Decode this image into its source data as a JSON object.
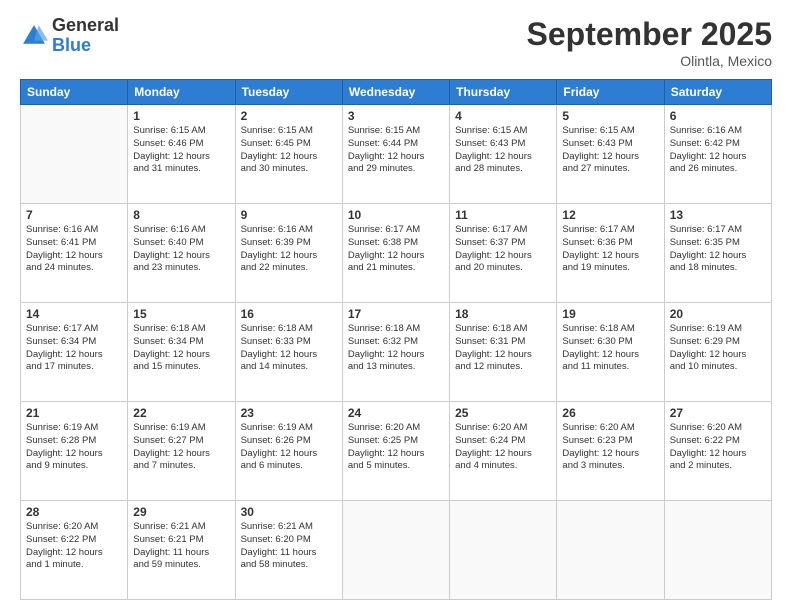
{
  "logo": {
    "general": "General",
    "blue": "Blue"
  },
  "header": {
    "month": "September 2025",
    "location": "Olintla, Mexico"
  },
  "weekdays": [
    "Sunday",
    "Monday",
    "Tuesday",
    "Wednesday",
    "Thursday",
    "Friday",
    "Saturday"
  ],
  "weeks": [
    [
      {
        "day": "",
        "info": ""
      },
      {
        "day": "1",
        "info": "Sunrise: 6:15 AM\nSunset: 6:46 PM\nDaylight: 12 hours\nand 31 minutes."
      },
      {
        "day": "2",
        "info": "Sunrise: 6:15 AM\nSunset: 6:45 PM\nDaylight: 12 hours\nand 30 minutes."
      },
      {
        "day": "3",
        "info": "Sunrise: 6:15 AM\nSunset: 6:44 PM\nDaylight: 12 hours\nand 29 minutes."
      },
      {
        "day": "4",
        "info": "Sunrise: 6:15 AM\nSunset: 6:43 PM\nDaylight: 12 hours\nand 28 minutes."
      },
      {
        "day": "5",
        "info": "Sunrise: 6:15 AM\nSunset: 6:43 PM\nDaylight: 12 hours\nand 27 minutes."
      },
      {
        "day": "6",
        "info": "Sunrise: 6:16 AM\nSunset: 6:42 PM\nDaylight: 12 hours\nand 26 minutes."
      }
    ],
    [
      {
        "day": "7",
        "info": "Sunrise: 6:16 AM\nSunset: 6:41 PM\nDaylight: 12 hours\nand 24 minutes."
      },
      {
        "day": "8",
        "info": "Sunrise: 6:16 AM\nSunset: 6:40 PM\nDaylight: 12 hours\nand 23 minutes."
      },
      {
        "day": "9",
        "info": "Sunrise: 6:16 AM\nSunset: 6:39 PM\nDaylight: 12 hours\nand 22 minutes."
      },
      {
        "day": "10",
        "info": "Sunrise: 6:17 AM\nSunset: 6:38 PM\nDaylight: 12 hours\nand 21 minutes."
      },
      {
        "day": "11",
        "info": "Sunrise: 6:17 AM\nSunset: 6:37 PM\nDaylight: 12 hours\nand 20 minutes."
      },
      {
        "day": "12",
        "info": "Sunrise: 6:17 AM\nSunset: 6:36 PM\nDaylight: 12 hours\nand 19 minutes."
      },
      {
        "day": "13",
        "info": "Sunrise: 6:17 AM\nSunset: 6:35 PM\nDaylight: 12 hours\nand 18 minutes."
      }
    ],
    [
      {
        "day": "14",
        "info": "Sunrise: 6:17 AM\nSunset: 6:34 PM\nDaylight: 12 hours\nand 17 minutes."
      },
      {
        "day": "15",
        "info": "Sunrise: 6:18 AM\nSunset: 6:34 PM\nDaylight: 12 hours\nand 15 minutes."
      },
      {
        "day": "16",
        "info": "Sunrise: 6:18 AM\nSunset: 6:33 PM\nDaylight: 12 hours\nand 14 minutes."
      },
      {
        "day": "17",
        "info": "Sunrise: 6:18 AM\nSunset: 6:32 PM\nDaylight: 12 hours\nand 13 minutes."
      },
      {
        "day": "18",
        "info": "Sunrise: 6:18 AM\nSunset: 6:31 PM\nDaylight: 12 hours\nand 12 minutes."
      },
      {
        "day": "19",
        "info": "Sunrise: 6:18 AM\nSunset: 6:30 PM\nDaylight: 12 hours\nand 11 minutes."
      },
      {
        "day": "20",
        "info": "Sunrise: 6:19 AM\nSunset: 6:29 PM\nDaylight: 12 hours\nand 10 minutes."
      }
    ],
    [
      {
        "day": "21",
        "info": "Sunrise: 6:19 AM\nSunset: 6:28 PM\nDaylight: 12 hours\nand 9 minutes."
      },
      {
        "day": "22",
        "info": "Sunrise: 6:19 AM\nSunset: 6:27 PM\nDaylight: 12 hours\nand 7 minutes."
      },
      {
        "day": "23",
        "info": "Sunrise: 6:19 AM\nSunset: 6:26 PM\nDaylight: 12 hours\nand 6 minutes."
      },
      {
        "day": "24",
        "info": "Sunrise: 6:20 AM\nSunset: 6:25 PM\nDaylight: 12 hours\nand 5 minutes."
      },
      {
        "day": "25",
        "info": "Sunrise: 6:20 AM\nSunset: 6:24 PM\nDaylight: 12 hours\nand 4 minutes."
      },
      {
        "day": "26",
        "info": "Sunrise: 6:20 AM\nSunset: 6:23 PM\nDaylight: 12 hours\nand 3 minutes."
      },
      {
        "day": "27",
        "info": "Sunrise: 6:20 AM\nSunset: 6:22 PM\nDaylight: 12 hours\nand 2 minutes."
      }
    ],
    [
      {
        "day": "28",
        "info": "Sunrise: 6:20 AM\nSunset: 6:22 PM\nDaylight: 12 hours\nand 1 minute."
      },
      {
        "day": "29",
        "info": "Sunrise: 6:21 AM\nSunset: 6:21 PM\nDaylight: 11 hours\nand 59 minutes."
      },
      {
        "day": "30",
        "info": "Sunrise: 6:21 AM\nSunset: 6:20 PM\nDaylight: 11 hours\nand 58 minutes."
      },
      {
        "day": "",
        "info": ""
      },
      {
        "day": "",
        "info": ""
      },
      {
        "day": "",
        "info": ""
      },
      {
        "day": "",
        "info": ""
      }
    ]
  ]
}
